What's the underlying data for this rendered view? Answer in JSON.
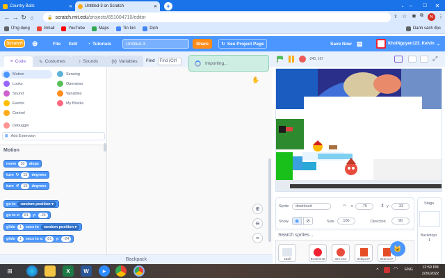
{
  "browser": {
    "tabs": [
      {
        "title": "Country Balls"
      },
      {
        "title": "Untitled-3 on Scratch"
      }
    ],
    "url_host": "scratch.mit.edu",
    "url_path": "/projects/651004710/editor",
    "profile_initial": "N",
    "bookmarks": [
      "Ứng dụng",
      "Gmail",
      "YouTube",
      "Maps",
      "Tin tức",
      "Dịch"
    ],
    "reading_list": "Danh sách đọc"
  },
  "menubar": {
    "logo": "Scratch",
    "file": "File",
    "edit": "Edit",
    "tutorials": "Tutorials",
    "project_title": "Untitled-3",
    "share": "Share",
    "see_project_page": "See Project Page",
    "save_now": "Save Now",
    "username": "KhoiNguyen123_Kelvin"
  },
  "editor_tabs": {
    "code": "Code",
    "costumes": "Costumes",
    "sounds": "Sounds",
    "variables": "Variables"
  },
  "find": {
    "label": "Find",
    "placeholder": "Find (Ctrl"
  },
  "importing_text": "Importing...",
  "categories": [
    {
      "label": "Motion",
      "color": "#4c97ff"
    },
    {
      "label": "Looks",
      "color": "#9966ff"
    },
    {
      "label": "Sound",
      "color": "#cf63cf"
    },
    {
      "label": "Events",
      "color": "#ffbf00"
    },
    {
      "label": "Control",
      "color": "#ffab19"
    },
    {
      "label": "Sensing",
      "color": "#5cb1d6"
    },
    {
      "label": "Operators",
      "color": "#59c059"
    },
    {
      "label": "Variables",
      "color": "#ff8c1a"
    },
    {
      "label": "My Blocks",
      "color": "#ff6680"
    }
  ],
  "debugger": "Debugger",
  "add_extension": "Add Extension",
  "palette": {
    "heading": "Motion",
    "move": {
      "text1": "move",
      "val": "10",
      "text2": "steps"
    },
    "turn_right": {
      "text1": "turn",
      "val": "15",
      "text2": "degrees"
    },
    "turn_left": {
      "text1": "turn",
      "val": "15",
      "text2": "degrees"
    },
    "goto": {
      "text1": "go to",
      "dropdown": "random position"
    },
    "goto_xy": {
      "text1": "go to x:",
      "x": "81",
      "text2": "y:",
      "y": "-24"
    },
    "glide_to": {
      "text1": "glide",
      "val": "1",
      "text2": "secs to",
      "dropdown": "random position"
    },
    "glide_xy": {
      "text1": "glide",
      "val": "1",
      "text2": "secs to x:",
      "x": "81",
      "text3": "y:",
      "y": "-24"
    }
  },
  "stage": {
    "coords": "-240, 107"
  },
  "sprite_info": {
    "sprite_label": "Sprite",
    "sprite_name": "download",
    "x_label": "x",
    "x_value": "-75",
    "y_label": "y",
    "y_value": "-33",
    "show_label": "Show",
    "size_label": "Size",
    "size_value": "100",
    "direction_label": "Direction",
    "direction_value": "90"
  },
  "search_sprites": "Search sprites...",
  "sprites": [
    "1Ball",
    "Bro5mm3t",
    "404-pice",
    "845ipu47",
    "845mu47"
  ],
  "stage_panel": {
    "label": "Stage",
    "backdrops_label": "Backdrops",
    "backdrops_count": "1"
  },
  "backpack": "Backpack",
  "taskbar": {
    "lang": "ENG",
    "time": "12:59 PM",
    "date": "2/26/2022"
  }
}
